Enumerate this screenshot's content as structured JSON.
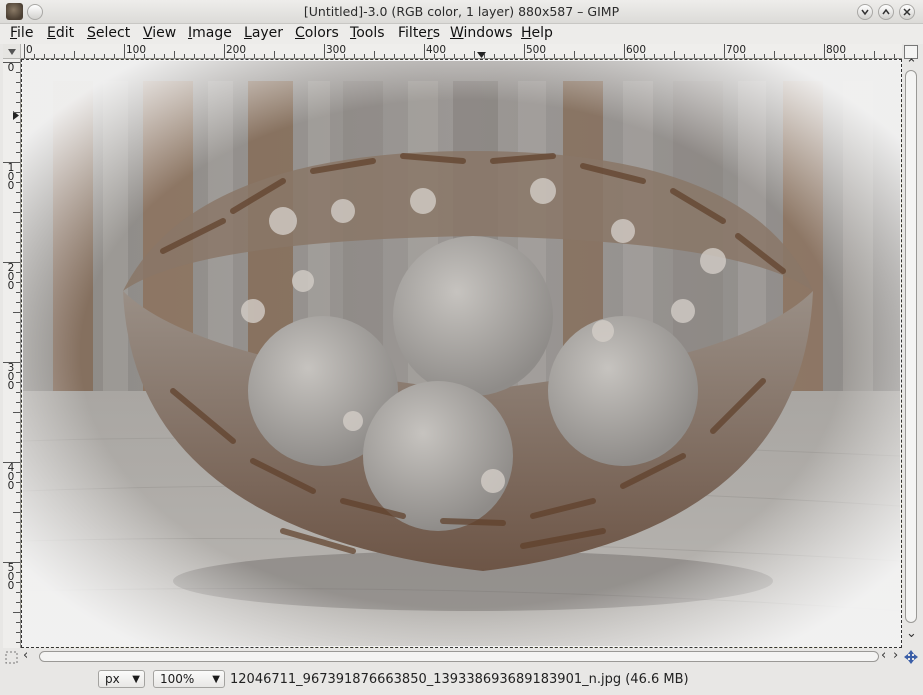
{
  "window": {
    "title": "[Untitled]-3.0 (RGB color, 1 layer) 880x587 – GIMP"
  },
  "menu": {
    "items": [
      {
        "label": "File",
        "mnemonic": "F",
        "rest": "ile"
      },
      {
        "label": "Edit",
        "mnemonic": "E",
        "rest": "dit"
      },
      {
        "label": "Select",
        "mnemonic": "S",
        "rest": "elect"
      },
      {
        "label": "View",
        "mnemonic": "V",
        "rest": "iew"
      },
      {
        "label": "Image",
        "mnemonic": "I",
        "rest": "mage"
      },
      {
        "label": "Layer",
        "mnemonic": "L",
        "rest": "ayer"
      },
      {
        "label": "Colors",
        "mnemonic": "C",
        "rest": "olors"
      },
      {
        "label": "Tools",
        "mnemonic": "T",
        "rest": "ools"
      },
      {
        "label": "Filters",
        "mnemonic": "r",
        "pre": "Filte",
        "rest": "s"
      },
      {
        "label": "Windows",
        "mnemonic": "W",
        "rest": "indows"
      },
      {
        "label": "Help",
        "mnemonic": "H",
        "rest": "elp"
      }
    ]
  },
  "rulers": {
    "horizontal": [
      "0",
      "100",
      "200",
      "300",
      "400",
      "500",
      "600",
      "700",
      "800"
    ],
    "vertical": [
      "0",
      "100",
      "200",
      "300",
      "400",
      "500"
    ]
  },
  "statusbar": {
    "unit": "px",
    "zoom": "100%",
    "info": "12046711_967391876663850_1393386936891839 01_n.jpg (46.6 MB)"
  },
  "colors": {
    "sepia": "#8a4f22",
    "selection_dash": "#d4c200"
  },
  "icons": {
    "app": "gimp-wilber-icon",
    "close": "close-icon",
    "maximize": "maximize-icon",
    "minimize": "minimize-icon",
    "navigate": "navigate-icon"
  }
}
